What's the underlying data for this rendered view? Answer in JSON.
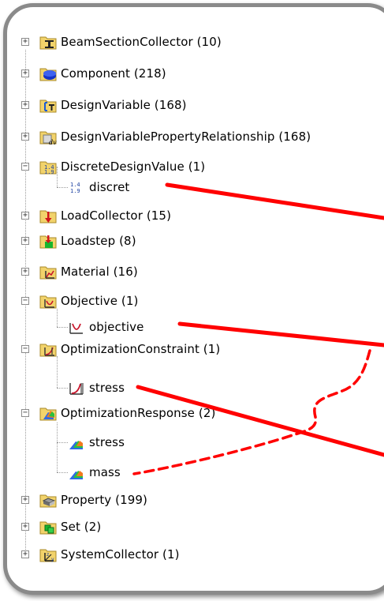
{
  "tree": {
    "items": [
      {
        "label": "BeamSectionCollector (10)",
        "level": 0,
        "expander": "+",
        "icon": "beam-section-icon"
      },
      {
        "label": "Component (218)",
        "level": 0,
        "expander": "+",
        "icon": "component-icon"
      },
      {
        "label": "DesignVariable (168)",
        "level": 0,
        "expander": "+",
        "icon": "design-variable-icon"
      },
      {
        "label": "DesignVariablePropertyRelationship (168)",
        "level": 0,
        "expander": "+",
        "icon": "dv-property-relationship-icon"
      },
      {
        "label": "DiscreteDesignValue (1)",
        "level": 0,
        "expander": "-",
        "icon": "discrete-design-value-icon"
      },
      {
        "label": "discret",
        "level": 1,
        "expander": "",
        "icon": "discrete-value-icon"
      },
      {
        "label": "LoadCollector (15)",
        "level": 0,
        "expander": "+",
        "icon": "load-collector-icon"
      },
      {
        "label": "Loadstep (8)",
        "level": 0,
        "expander": "+",
        "icon": "loadstep-icon"
      },
      {
        "label": "Material (16)",
        "level": 0,
        "expander": "+",
        "icon": "material-icon"
      },
      {
        "label": "Objective (1)",
        "level": 0,
        "expander": "-",
        "icon": "objective-folder-icon"
      },
      {
        "label": "objective",
        "level": 1,
        "expander": "",
        "icon": "objective-icon"
      },
      {
        "label": "OptimizationConstraint (1)",
        "level": 0,
        "expander": "-",
        "icon": "constraint-folder-icon"
      },
      {
        "label": "stress",
        "level": 1,
        "expander": "",
        "icon": "constraint-icon"
      },
      {
        "label": "OptimizationResponse (2)",
        "level": 0,
        "expander": "-",
        "icon": "response-folder-icon"
      },
      {
        "label": "stress",
        "level": 1,
        "expander": "",
        "icon": "response-icon"
      },
      {
        "label": "mass",
        "level": 1,
        "expander": "",
        "icon": "response-icon"
      },
      {
        "label": "Property (199)",
        "level": 0,
        "expander": "+",
        "icon": "property-icon"
      },
      {
        "label": "Set (2)",
        "level": 0,
        "expander": "+",
        "icon": "set-icon"
      },
      {
        "label": "SystemCollector (1)",
        "level": 0,
        "expander": "+",
        "icon": "system-collector-icon"
      }
    ]
  },
  "colors": {
    "arrow": "#ff0000",
    "frame": "#8a8a8a",
    "folder": "#f2d36b"
  }
}
